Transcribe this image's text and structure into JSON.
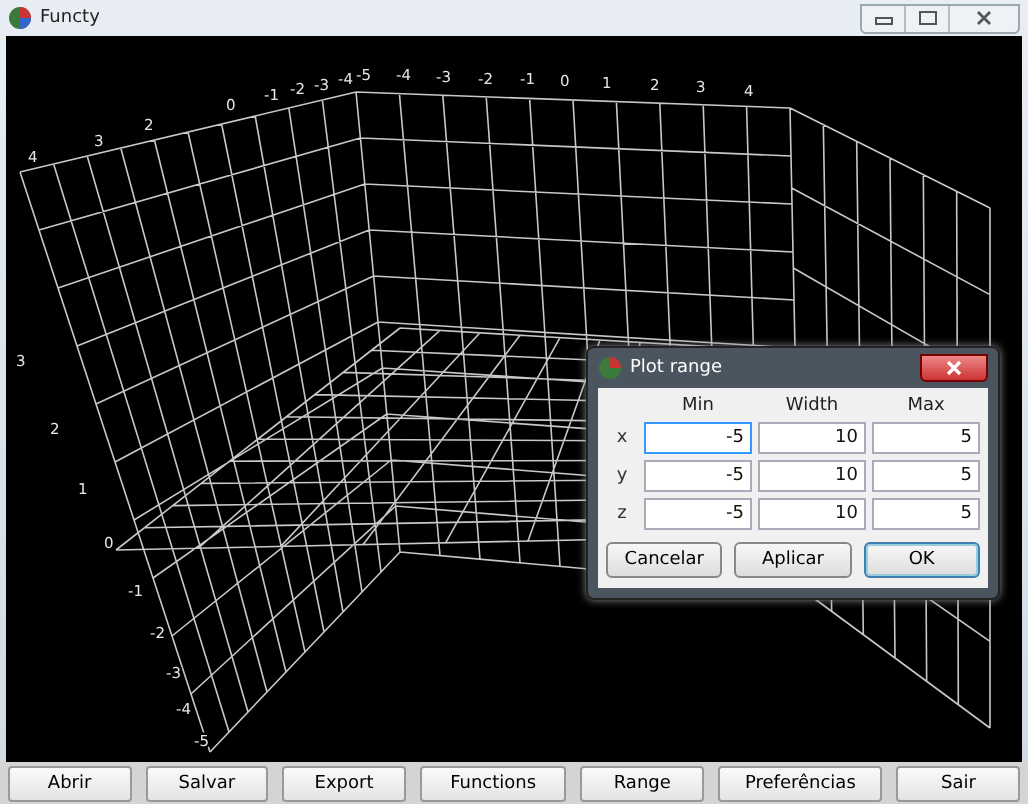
{
  "window": {
    "title": "Functy"
  },
  "plot": {
    "axis_labels": [
      "4",
      "3",
      "2",
      "0",
      "-1",
      "-2",
      "-3",
      "-4",
      "-5",
      "-4",
      "-3",
      "-2",
      "-1",
      "0",
      "1",
      "2",
      "3",
      "4",
      "3",
      "2",
      "1",
      "0",
      "-1",
      "-2",
      "-3",
      "-4",
      "-5"
    ]
  },
  "dialog": {
    "title": "Plot range",
    "columns": [
      "Min",
      "Width",
      "Max"
    ],
    "rows": [
      {
        "label": "x",
        "values": [
          "-5",
          "10",
          "5"
        ],
        "focused": true
      },
      {
        "label": "y",
        "values": [
          "-5",
          "10",
          "5"
        ],
        "focused": false
      },
      {
        "label": "z",
        "values": [
          "-5",
          "10",
          "5"
        ],
        "focused": false
      }
    ],
    "buttons": [
      {
        "label": "Cancelar",
        "default": false
      },
      {
        "label": "Aplicar",
        "default": false
      },
      {
        "label": "OK",
        "default": true
      }
    ]
  },
  "toolbar": [
    "Abrir",
    "Salvar",
    "Export",
    "Functions",
    "Range",
    "Preferências",
    "Sair"
  ]
}
